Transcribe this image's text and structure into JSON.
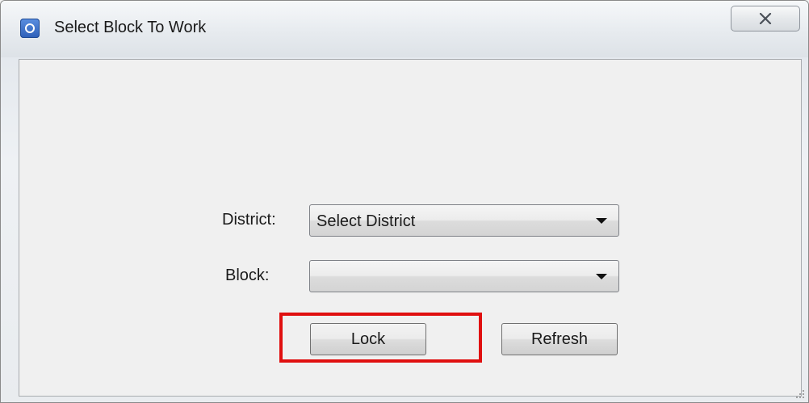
{
  "window": {
    "title": "Select Block To Work"
  },
  "icons": {
    "app": "app-icon",
    "close": "close-icon",
    "dropdown": "chevron-down-icon",
    "grip": "resize-grip-icon"
  },
  "form": {
    "district_label": "District:",
    "district_value": "Select District",
    "block_label": "Block:",
    "block_value": ""
  },
  "buttons": {
    "lock_label": "Lock",
    "refresh_label": "Refresh"
  },
  "colors": {
    "highlight": "#e01010"
  }
}
